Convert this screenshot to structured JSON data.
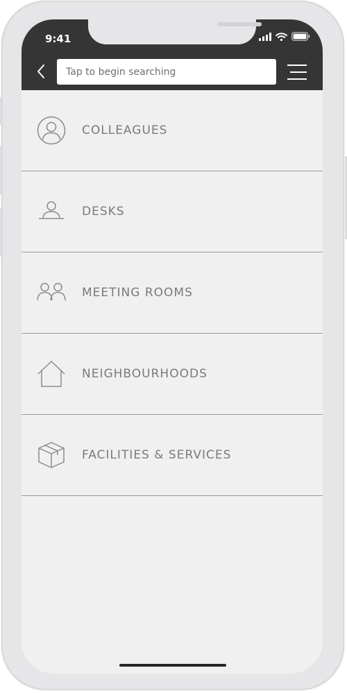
{
  "status_bar": {
    "time": "9:41"
  },
  "header": {
    "search_placeholder": "Tap to begin searching"
  },
  "menu": {
    "items": [
      {
        "label": "COLLEAGUES",
        "icon": "person-circle-icon"
      },
      {
        "label": "DESKS",
        "icon": "desk-person-icon"
      },
      {
        "label": "MEETING ROOMS",
        "icon": "people-group-icon"
      },
      {
        "label": "NEIGHBOURHOODS",
        "icon": "house-icon"
      },
      {
        "label": "FACILITIES & SERVICES",
        "icon": "package-box-icon"
      }
    ]
  },
  "colors": {
    "header_bg": "#353535",
    "screen_bg": "#f0f0f0",
    "label_text": "#7a7a7a",
    "icon_stroke": "#8a8a8a",
    "divider": "#9a9a9a"
  }
}
